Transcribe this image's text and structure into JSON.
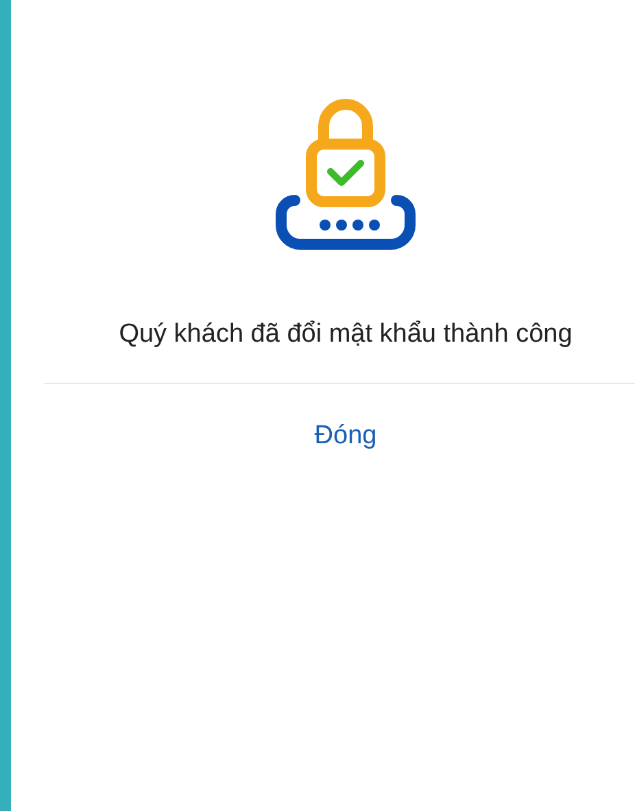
{
  "dialog": {
    "message": "Quý khách đã đổi mật khẩu thành công",
    "close_button": "Đóng"
  }
}
